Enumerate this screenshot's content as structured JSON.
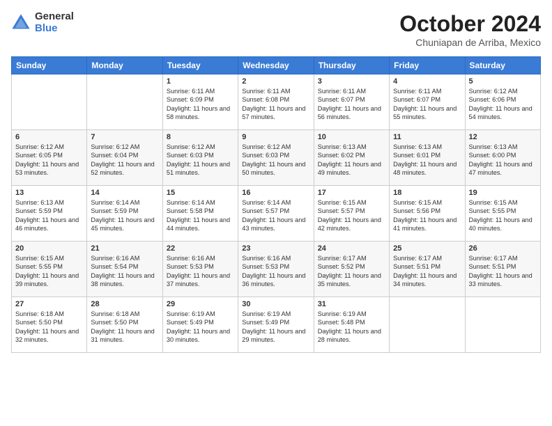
{
  "header": {
    "logo_general": "General",
    "logo_blue": "Blue",
    "month_title": "October 2024",
    "location": "Chuniapan de Arriba, Mexico"
  },
  "weekdays": [
    "Sunday",
    "Monday",
    "Tuesday",
    "Wednesday",
    "Thursday",
    "Friday",
    "Saturday"
  ],
  "weeks": [
    [
      {
        "day": "",
        "info": ""
      },
      {
        "day": "",
        "info": ""
      },
      {
        "day": "1",
        "sunrise": "Sunrise: 6:11 AM",
        "sunset": "Sunset: 6:09 PM",
        "daylight": "Daylight: 11 hours and 58 minutes."
      },
      {
        "day": "2",
        "sunrise": "Sunrise: 6:11 AM",
        "sunset": "Sunset: 6:08 PM",
        "daylight": "Daylight: 11 hours and 57 minutes."
      },
      {
        "day": "3",
        "sunrise": "Sunrise: 6:11 AM",
        "sunset": "Sunset: 6:07 PM",
        "daylight": "Daylight: 11 hours and 56 minutes."
      },
      {
        "day": "4",
        "sunrise": "Sunrise: 6:11 AM",
        "sunset": "Sunset: 6:07 PM",
        "daylight": "Daylight: 11 hours and 55 minutes."
      },
      {
        "day": "5",
        "sunrise": "Sunrise: 6:12 AM",
        "sunset": "Sunset: 6:06 PM",
        "daylight": "Daylight: 11 hours and 54 minutes."
      }
    ],
    [
      {
        "day": "6",
        "sunrise": "Sunrise: 6:12 AM",
        "sunset": "Sunset: 6:05 PM",
        "daylight": "Daylight: 11 hours and 53 minutes."
      },
      {
        "day": "7",
        "sunrise": "Sunrise: 6:12 AM",
        "sunset": "Sunset: 6:04 PM",
        "daylight": "Daylight: 11 hours and 52 minutes."
      },
      {
        "day": "8",
        "sunrise": "Sunrise: 6:12 AM",
        "sunset": "Sunset: 6:03 PM",
        "daylight": "Daylight: 11 hours and 51 minutes."
      },
      {
        "day": "9",
        "sunrise": "Sunrise: 6:12 AM",
        "sunset": "Sunset: 6:03 PM",
        "daylight": "Daylight: 11 hours and 50 minutes."
      },
      {
        "day": "10",
        "sunrise": "Sunrise: 6:13 AM",
        "sunset": "Sunset: 6:02 PM",
        "daylight": "Daylight: 11 hours and 49 minutes."
      },
      {
        "day": "11",
        "sunrise": "Sunrise: 6:13 AM",
        "sunset": "Sunset: 6:01 PM",
        "daylight": "Daylight: 11 hours and 48 minutes."
      },
      {
        "day": "12",
        "sunrise": "Sunrise: 6:13 AM",
        "sunset": "Sunset: 6:00 PM",
        "daylight": "Daylight: 11 hours and 47 minutes."
      }
    ],
    [
      {
        "day": "13",
        "sunrise": "Sunrise: 6:13 AM",
        "sunset": "Sunset: 5:59 PM",
        "daylight": "Daylight: 11 hours and 46 minutes."
      },
      {
        "day": "14",
        "sunrise": "Sunrise: 6:14 AM",
        "sunset": "Sunset: 5:59 PM",
        "daylight": "Daylight: 11 hours and 45 minutes."
      },
      {
        "day": "15",
        "sunrise": "Sunrise: 6:14 AM",
        "sunset": "Sunset: 5:58 PM",
        "daylight": "Daylight: 11 hours and 44 minutes."
      },
      {
        "day": "16",
        "sunrise": "Sunrise: 6:14 AM",
        "sunset": "Sunset: 5:57 PM",
        "daylight": "Daylight: 11 hours and 43 minutes."
      },
      {
        "day": "17",
        "sunrise": "Sunrise: 6:15 AM",
        "sunset": "Sunset: 5:57 PM",
        "daylight": "Daylight: 11 hours and 42 minutes."
      },
      {
        "day": "18",
        "sunrise": "Sunrise: 6:15 AM",
        "sunset": "Sunset: 5:56 PM",
        "daylight": "Daylight: 11 hours and 41 minutes."
      },
      {
        "day": "19",
        "sunrise": "Sunrise: 6:15 AM",
        "sunset": "Sunset: 5:55 PM",
        "daylight": "Daylight: 11 hours and 40 minutes."
      }
    ],
    [
      {
        "day": "20",
        "sunrise": "Sunrise: 6:15 AM",
        "sunset": "Sunset: 5:55 PM",
        "daylight": "Daylight: 11 hours and 39 minutes."
      },
      {
        "day": "21",
        "sunrise": "Sunrise: 6:16 AM",
        "sunset": "Sunset: 5:54 PM",
        "daylight": "Daylight: 11 hours and 38 minutes."
      },
      {
        "day": "22",
        "sunrise": "Sunrise: 6:16 AM",
        "sunset": "Sunset: 5:53 PM",
        "daylight": "Daylight: 11 hours and 37 minutes."
      },
      {
        "day": "23",
        "sunrise": "Sunrise: 6:16 AM",
        "sunset": "Sunset: 5:53 PM",
        "daylight": "Daylight: 11 hours and 36 minutes."
      },
      {
        "day": "24",
        "sunrise": "Sunrise: 6:17 AM",
        "sunset": "Sunset: 5:52 PM",
        "daylight": "Daylight: 11 hours and 35 minutes."
      },
      {
        "day": "25",
        "sunrise": "Sunrise: 6:17 AM",
        "sunset": "Sunset: 5:51 PM",
        "daylight": "Daylight: 11 hours and 34 minutes."
      },
      {
        "day": "26",
        "sunrise": "Sunrise: 6:17 AM",
        "sunset": "Sunset: 5:51 PM",
        "daylight": "Daylight: 11 hours and 33 minutes."
      }
    ],
    [
      {
        "day": "27",
        "sunrise": "Sunrise: 6:18 AM",
        "sunset": "Sunset: 5:50 PM",
        "daylight": "Daylight: 11 hours and 32 minutes."
      },
      {
        "day": "28",
        "sunrise": "Sunrise: 6:18 AM",
        "sunset": "Sunset: 5:50 PM",
        "daylight": "Daylight: 11 hours and 31 minutes."
      },
      {
        "day": "29",
        "sunrise": "Sunrise: 6:19 AM",
        "sunset": "Sunset: 5:49 PM",
        "daylight": "Daylight: 11 hours and 30 minutes."
      },
      {
        "day": "30",
        "sunrise": "Sunrise: 6:19 AM",
        "sunset": "Sunset: 5:49 PM",
        "daylight": "Daylight: 11 hours and 29 minutes."
      },
      {
        "day": "31",
        "sunrise": "Sunrise: 6:19 AM",
        "sunset": "Sunset: 5:48 PM",
        "daylight": "Daylight: 11 hours and 28 minutes."
      },
      {
        "day": "",
        "info": ""
      },
      {
        "day": "",
        "info": ""
      }
    ]
  ]
}
